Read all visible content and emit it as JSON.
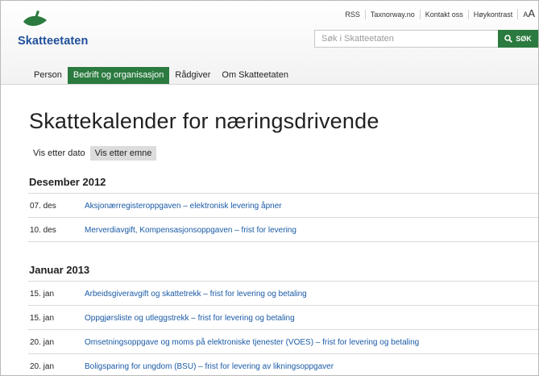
{
  "header": {
    "brand": "Skatteetaten",
    "utility_links": [
      "RSS",
      "Taxnorway.no",
      "Kontakt oss",
      "Høykontrast"
    ],
    "text_size_small": "A",
    "text_size_large": "A",
    "search_placeholder": "Søk i Skatteetaten",
    "search_button": "SØK",
    "colors": {
      "brand_green": "#2b7a3f",
      "brand_blue": "#1f4f9a",
      "link_blue": "#1a5aa6"
    }
  },
  "nav": {
    "tabs": [
      "Person",
      "Bedrift og organisasjon",
      "Rådgiver",
      "Om Skatteetaten"
    ],
    "active": "Bedrift og organisasjon"
  },
  "main": {
    "title": "Skattekalender for næringsdrivende",
    "view_tabs": [
      "Vis etter dato",
      "Vis etter emne"
    ],
    "sections": [
      {
        "month": "Desember 2012",
        "entries": [
          {
            "date": "07. des",
            "text": "Aksjonærregisteroppgaven – elektronisk levering åpner"
          },
          {
            "date": "10. des",
            "text": "Merverdiavgift, Kompensasjonsoppgaven – frist for levering"
          }
        ]
      },
      {
        "month": "Januar 2013",
        "entries": [
          {
            "date": "15. jan",
            "text": "Arbeidsgiveravgift og skattetrekk – frist for levering og betaling"
          },
          {
            "date": "15. jan",
            "text": "Oppgjørsliste og utleggstrekk – frist for levering og betaling"
          },
          {
            "date": "20. jan",
            "text": "Omsetningsoppgave og moms på elektroniske tjenester (VOES) – frist for levering og betaling"
          },
          {
            "date": "20. jan",
            "text": "Boligsparing for ungdom (BSU) – frist for levering av likningsoppgaver"
          }
        ]
      }
    ]
  }
}
